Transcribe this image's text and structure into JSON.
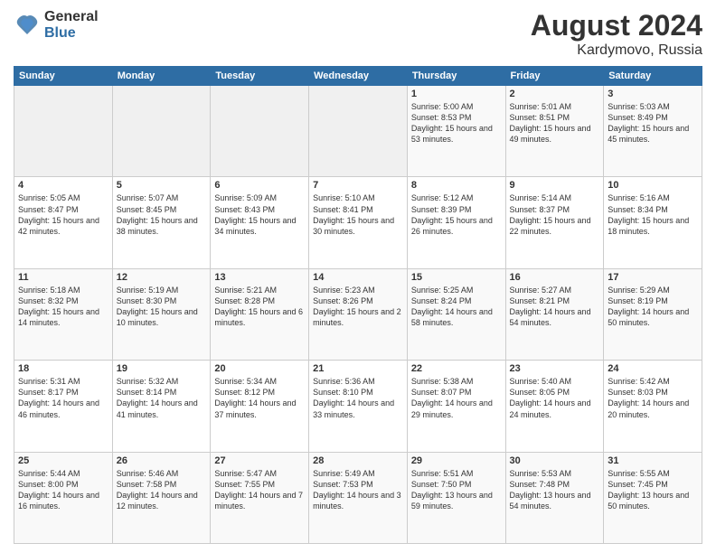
{
  "logo": {
    "general": "General",
    "blue": "Blue"
  },
  "title": "August 2024",
  "location": "Kardymovo, Russia",
  "days_header": [
    "Sunday",
    "Monday",
    "Tuesday",
    "Wednesday",
    "Thursday",
    "Friday",
    "Saturday"
  ],
  "weeks": [
    [
      {
        "day": "",
        "sunrise": "",
        "sunset": "",
        "daylight": ""
      },
      {
        "day": "",
        "sunrise": "",
        "sunset": "",
        "daylight": ""
      },
      {
        "day": "",
        "sunrise": "",
        "sunset": "",
        "daylight": ""
      },
      {
        "day": "",
        "sunrise": "",
        "sunset": "",
        "daylight": ""
      },
      {
        "day": "1",
        "sunrise": "Sunrise: 5:00 AM",
        "sunset": "Sunset: 8:53 PM",
        "daylight": "Daylight: 15 hours and 53 minutes."
      },
      {
        "day": "2",
        "sunrise": "Sunrise: 5:01 AM",
        "sunset": "Sunset: 8:51 PM",
        "daylight": "Daylight: 15 hours and 49 minutes."
      },
      {
        "day": "3",
        "sunrise": "Sunrise: 5:03 AM",
        "sunset": "Sunset: 8:49 PM",
        "daylight": "Daylight: 15 hours and 45 minutes."
      }
    ],
    [
      {
        "day": "4",
        "sunrise": "Sunrise: 5:05 AM",
        "sunset": "Sunset: 8:47 PM",
        "daylight": "Daylight: 15 hours and 42 minutes."
      },
      {
        "day": "5",
        "sunrise": "Sunrise: 5:07 AM",
        "sunset": "Sunset: 8:45 PM",
        "daylight": "Daylight: 15 hours and 38 minutes."
      },
      {
        "day": "6",
        "sunrise": "Sunrise: 5:09 AM",
        "sunset": "Sunset: 8:43 PM",
        "daylight": "Daylight: 15 hours and 34 minutes."
      },
      {
        "day": "7",
        "sunrise": "Sunrise: 5:10 AM",
        "sunset": "Sunset: 8:41 PM",
        "daylight": "Daylight: 15 hours and 30 minutes."
      },
      {
        "day": "8",
        "sunrise": "Sunrise: 5:12 AM",
        "sunset": "Sunset: 8:39 PM",
        "daylight": "Daylight: 15 hours and 26 minutes."
      },
      {
        "day": "9",
        "sunrise": "Sunrise: 5:14 AM",
        "sunset": "Sunset: 8:37 PM",
        "daylight": "Daylight: 15 hours and 22 minutes."
      },
      {
        "day": "10",
        "sunrise": "Sunrise: 5:16 AM",
        "sunset": "Sunset: 8:34 PM",
        "daylight": "Daylight: 15 hours and 18 minutes."
      }
    ],
    [
      {
        "day": "11",
        "sunrise": "Sunrise: 5:18 AM",
        "sunset": "Sunset: 8:32 PM",
        "daylight": "Daylight: 15 hours and 14 minutes."
      },
      {
        "day": "12",
        "sunrise": "Sunrise: 5:19 AM",
        "sunset": "Sunset: 8:30 PM",
        "daylight": "Daylight: 15 hours and 10 minutes."
      },
      {
        "day": "13",
        "sunrise": "Sunrise: 5:21 AM",
        "sunset": "Sunset: 8:28 PM",
        "daylight": "Daylight: 15 hours and 6 minutes."
      },
      {
        "day": "14",
        "sunrise": "Sunrise: 5:23 AM",
        "sunset": "Sunset: 8:26 PM",
        "daylight": "Daylight: 15 hours and 2 minutes."
      },
      {
        "day": "15",
        "sunrise": "Sunrise: 5:25 AM",
        "sunset": "Sunset: 8:24 PM",
        "daylight": "Daylight: 14 hours and 58 minutes."
      },
      {
        "day": "16",
        "sunrise": "Sunrise: 5:27 AM",
        "sunset": "Sunset: 8:21 PM",
        "daylight": "Daylight: 14 hours and 54 minutes."
      },
      {
        "day": "17",
        "sunrise": "Sunrise: 5:29 AM",
        "sunset": "Sunset: 8:19 PM",
        "daylight": "Daylight: 14 hours and 50 minutes."
      }
    ],
    [
      {
        "day": "18",
        "sunrise": "Sunrise: 5:31 AM",
        "sunset": "Sunset: 8:17 PM",
        "daylight": "Daylight: 14 hours and 46 minutes."
      },
      {
        "day": "19",
        "sunrise": "Sunrise: 5:32 AM",
        "sunset": "Sunset: 8:14 PM",
        "daylight": "Daylight: 14 hours and 41 minutes."
      },
      {
        "day": "20",
        "sunrise": "Sunrise: 5:34 AM",
        "sunset": "Sunset: 8:12 PM",
        "daylight": "Daylight: 14 hours and 37 minutes."
      },
      {
        "day": "21",
        "sunrise": "Sunrise: 5:36 AM",
        "sunset": "Sunset: 8:10 PM",
        "daylight": "Daylight: 14 hours and 33 minutes."
      },
      {
        "day": "22",
        "sunrise": "Sunrise: 5:38 AM",
        "sunset": "Sunset: 8:07 PM",
        "daylight": "Daylight: 14 hours and 29 minutes."
      },
      {
        "day": "23",
        "sunrise": "Sunrise: 5:40 AM",
        "sunset": "Sunset: 8:05 PM",
        "daylight": "Daylight: 14 hours and 24 minutes."
      },
      {
        "day": "24",
        "sunrise": "Sunrise: 5:42 AM",
        "sunset": "Sunset: 8:03 PM",
        "daylight": "Daylight: 14 hours and 20 minutes."
      }
    ],
    [
      {
        "day": "25",
        "sunrise": "Sunrise: 5:44 AM",
        "sunset": "Sunset: 8:00 PM",
        "daylight": "Daylight: 14 hours and 16 minutes."
      },
      {
        "day": "26",
        "sunrise": "Sunrise: 5:46 AM",
        "sunset": "Sunset: 7:58 PM",
        "daylight": "Daylight: 14 hours and 12 minutes."
      },
      {
        "day": "27",
        "sunrise": "Sunrise: 5:47 AM",
        "sunset": "Sunset: 7:55 PM",
        "daylight": "Daylight: 14 hours and 7 minutes."
      },
      {
        "day": "28",
        "sunrise": "Sunrise: 5:49 AM",
        "sunset": "Sunset: 7:53 PM",
        "daylight": "Daylight: 14 hours and 3 minutes."
      },
      {
        "day": "29",
        "sunrise": "Sunrise: 5:51 AM",
        "sunset": "Sunset: 7:50 PM",
        "daylight": "Daylight: 13 hours and 59 minutes."
      },
      {
        "day": "30",
        "sunrise": "Sunrise: 5:53 AM",
        "sunset": "Sunset: 7:48 PM",
        "daylight": "Daylight: 13 hours and 54 minutes."
      },
      {
        "day": "31",
        "sunrise": "Sunrise: 5:55 AM",
        "sunset": "Sunset: 7:45 PM",
        "daylight": "Daylight: 13 hours and 50 minutes."
      }
    ]
  ]
}
